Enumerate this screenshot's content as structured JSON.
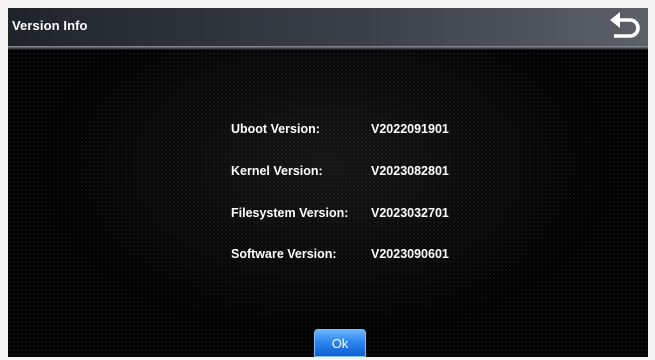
{
  "window": {
    "title": "Version Info",
    "back_icon": "return-arrow-icon"
  },
  "versions": [
    {
      "label": "Uboot Version:",
      "value": "V2022091901"
    },
    {
      "label": "Kernel Version:",
      "value": "V2023082801"
    },
    {
      "label": "Filesystem Version:",
      "value": "V2023032701"
    },
    {
      "label": "Software Version:",
      "value": "V2023090601"
    }
  ],
  "footer": {
    "ok_label": "Ok"
  },
  "colors": {
    "accent_button": "#2d86ee",
    "background": "#000000",
    "text": "#ffffff"
  }
}
